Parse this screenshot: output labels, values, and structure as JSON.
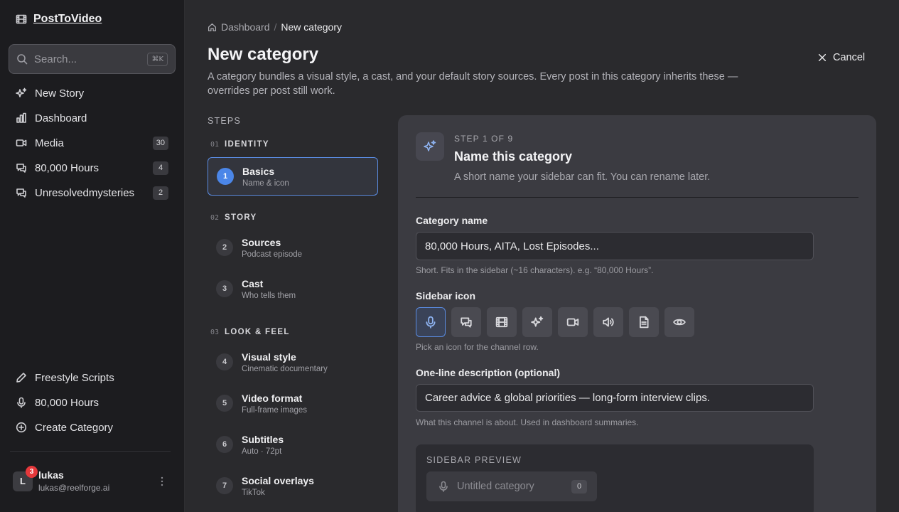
{
  "app": {
    "name": "PostToVideo"
  },
  "search": {
    "placeholder": "Search...",
    "shortcut": "⌘K"
  },
  "sidebar": {
    "nav": [
      {
        "label": "New Story",
        "icon": "sparkles-icon"
      },
      {
        "label": "Dashboard",
        "icon": "bar-chart-icon"
      },
      {
        "label": "Media",
        "icon": "video-icon",
        "count": "30"
      },
      {
        "label": "80,000 Hours",
        "icon": "chat-bubbles-icon",
        "count": "4"
      },
      {
        "label": "Unresolvedmysteries",
        "icon": "chat-bubbles-icon",
        "count": "2"
      }
    ],
    "footer_nav": [
      {
        "label": "Freestyle Scripts",
        "icon": "pencil-icon"
      },
      {
        "label": "80,000 Hours",
        "icon": "microphone-icon"
      },
      {
        "label": "Create Category",
        "icon": "plus-circle-icon"
      }
    ],
    "user": {
      "initial": "L",
      "name": "lukas",
      "email": "lukas@reelforge.ai",
      "notifications": "3"
    }
  },
  "breadcrumb": {
    "home": "Dashboard",
    "separator": "/",
    "current": "New category"
  },
  "page": {
    "title": "New category",
    "description": "A category bundles a visual style, a cast, and your default story sources. Every post in this category inherits these — overrides per post still work.",
    "cancel_label": "Cancel"
  },
  "steps": {
    "title": "STEPS",
    "groups": [
      {
        "num": "01",
        "name": "IDENTITY"
      },
      {
        "num": "02",
        "name": "STORY"
      },
      {
        "num": "03",
        "name": "LOOK & FEEL"
      }
    ],
    "items": [
      {
        "num": "1",
        "title": "Basics",
        "sub": "Name & icon",
        "active": true
      },
      {
        "num": "2",
        "title": "Sources",
        "sub": "Podcast episode"
      },
      {
        "num": "3",
        "title": "Cast",
        "sub": "Who tells them"
      },
      {
        "num": "4",
        "title": "Visual style",
        "sub": "Cinematic documentary"
      },
      {
        "num": "5",
        "title": "Video format",
        "sub": "Full-frame images"
      },
      {
        "num": "6",
        "title": "Subtitles",
        "sub": "Auto · 72pt"
      },
      {
        "num": "7",
        "title": "Social overlays",
        "sub": "TikTok"
      }
    ]
  },
  "form": {
    "step_of": "STEP 1 OF 9",
    "title": "Name this category",
    "subtitle": "A short name your sidebar can fit. You can rename later.",
    "name_label": "Category name",
    "name_placeholder": "80,000 Hours, AITA, Lost Episodes...",
    "name_hint": "Short. Fits in the sidebar (~16 characters). e.g. “80,000 Hours”.",
    "icon_label": "Sidebar icon",
    "icons": [
      "microphone-icon",
      "chat-bubbles-icon",
      "film-icon",
      "sparkles-icon",
      "video-icon",
      "speaker-icon",
      "document-icon",
      "eye-icon"
    ],
    "selected_icon": "microphone-icon",
    "icon_hint": "Pick an icon for the channel row.",
    "desc_label": "One-line description (optional)",
    "desc_value": "Career advice & global priorities — long-form interview clips.",
    "desc_hint": "What this channel is about. Used in dashboard summaries.",
    "preview_label": "SIDEBAR PREVIEW",
    "preview_name": "Untitled category",
    "preview_count": "0"
  },
  "colors": {
    "accent": "#4b86e8",
    "badge": "#e5383b",
    "background": "#2a2a2d",
    "sidebar": "#1c1c1f"
  }
}
